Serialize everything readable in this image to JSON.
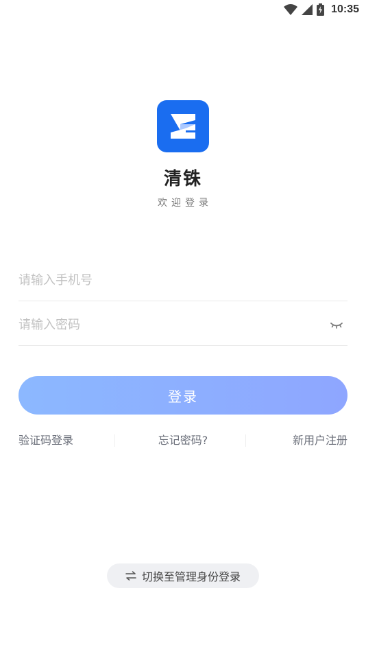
{
  "status_bar": {
    "time": "10:35",
    "icons": [
      "wifi-icon",
      "signal-icon",
      "battery-icon"
    ]
  },
  "app": {
    "name": "清铢",
    "welcome": "欢迎登录",
    "brand_color": "#1a6df0"
  },
  "form": {
    "phone_placeholder": "请输入手机号",
    "password_placeholder": "请输入密码",
    "login_label": "登录"
  },
  "links": {
    "sms_login": "验证码登录",
    "forgot_password": "忘记密码?",
    "register": "新用户注册"
  },
  "switch": {
    "label": "切换至管理身份登录",
    "icon": "swap-arrows-icon"
  }
}
